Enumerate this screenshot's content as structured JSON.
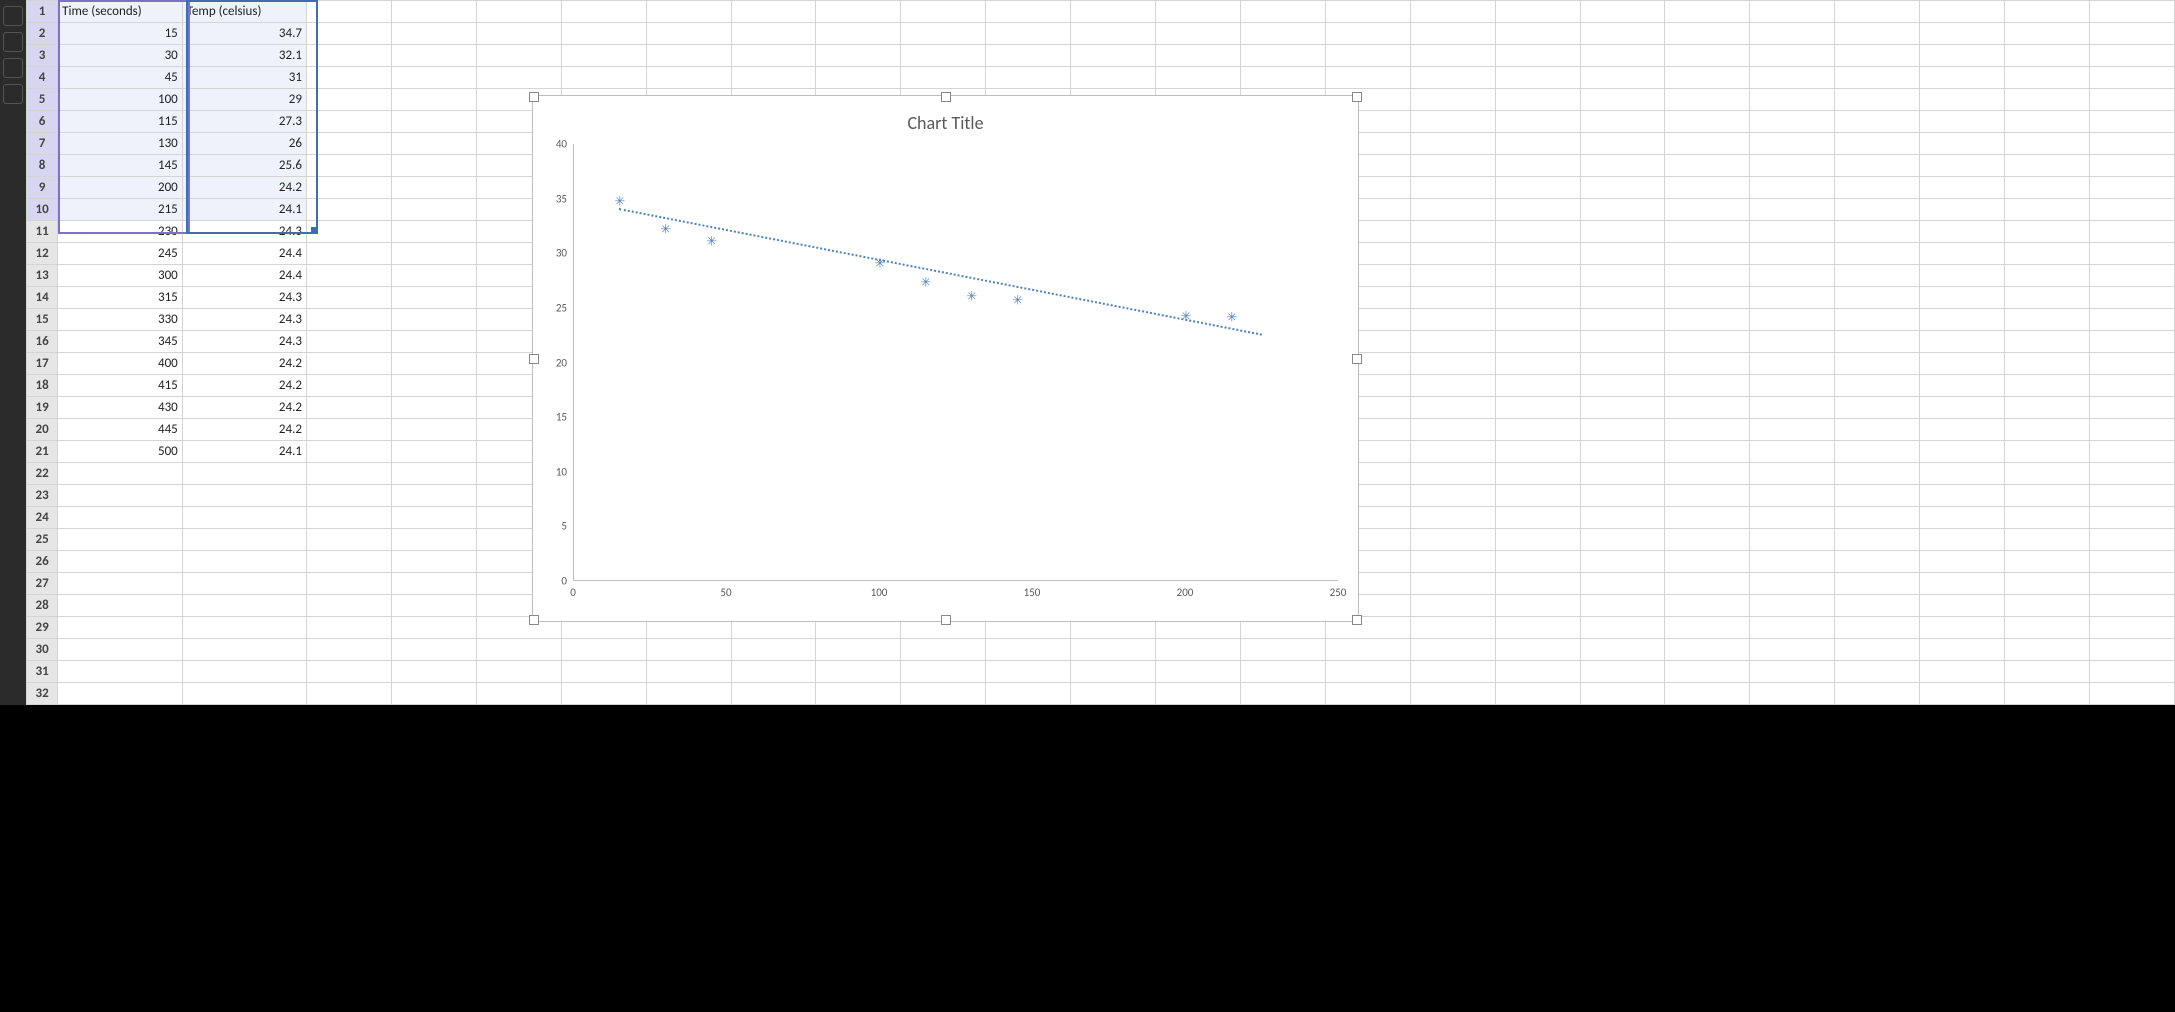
{
  "headers": {
    "colA": "Time (seconds)",
    "colB": "Temp (celsius)"
  },
  "rows": [
    {
      "n": 1,
      "a": "Time (seconds)",
      "b": "Temp (celsius)",
      "hdr": true
    },
    {
      "n": 2,
      "a": 15,
      "b": 34.7
    },
    {
      "n": 3,
      "a": 30,
      "b": 32.1
    },
    {
      "n": 4,
      "a": 45,
      "b": 31
    },
    {
      "n": 5,
      "a": 100,
      "b": 29
    },
    {
      "n": 6,
      "a": 115,
      "b": 27.3
    },
    {
      "n": 7,
      "a": 130,
      "b": 26
    },
    {
      "n": 8,
      "a": 145,
      "b": 25.6
    },
    {
      "n": 9,
      "a": 200,
      "b": 24.2
    },
    {
      "n": 10,
      "a": 215,
      "b": 24.1
    },
    {
      "n": 11,
      "a": 230,
      "b": 24.3
    },
    {
      "n": 12,
      "a": 245,
      "b": 24.4
    },
    {
      "n": 13,
      "a": 300,
      "b": 24.4
    },
    {
      "n": 14,
      "a": 315,
      "b": 24.3
    },
    {
      "n": 15,
      "a": 330,
      "b": 24.3
    },
    {
      "n": 16,
      "a": 345,
      "b": 24.3
    },
    {
      "n": 17,
      "a": 400,
      "b": 24.2
    },
    {
      "n": 18,
      "a": 415,
      "b": 24.2
    },
    {
      "n": 19,
      "a": 430,
      "b": 24.2
    },
    {
      "n": 20,
      "a": 445,
      "b": 24.2
    },
    {
      "n": 21,
      "a": 500,
      "b": 24.1
    },
    {
      "n": 22
    },
    {
      "n": 23
    },
    {
      "n": 24
    },
    {
      "n": 25
    },
    {
      "n": 26
    },
    {
      "n": 27
    },
    {
      "n": 28
    },
    {
      "n": 29
    },
    {
      "n": 30
    },
    {
      "n": 31
    },
    {
      "n": 32
    }
  ],
  "selection": {
    "first_row": 1,
    "last_row": 10,
    "cols": [
      "A",
      "B"
    ]
  },
  "chart_data": {
    "type": "scatter",
    "title": "Chart Title",
    "xlabel": "",
    "ylabel": "",
    "xlim": [
      0,
      250
    ],
    "ylim": [
      0,
      40
    ],
    "x_ticks": [
      0,
      50,
      100,
      150,
      200,
      250
    ],
    "y_ticks": [
      0,
      5,
      10,
      15,
      20,
      25,
      30,
      35,
      40
    ],
    "series": [
      {
        "name": "Temp (celsius)",
        "x": [
          15,
          30,
          45,
          100,
          115,
          130,
          145,
          200,
          215
        ],
        "y": [
          34.7,
          32.1,
          31,
          29,
          27.3,
          26,
          25.6,
          24.2,
          24.1
        ]
      }
    ],
    "trendline": {
      "x0": 15,
      "y0": 34.0,
      "x1": 225,
      "y1": 22.5,
      "style": "dotted"
    }
  },
  "num_blank_cols": 22
}
